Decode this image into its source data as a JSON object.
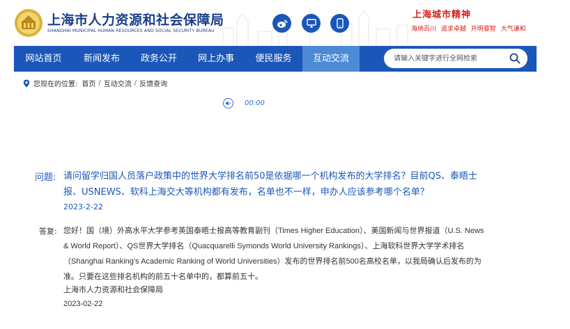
{
  "header": {
    "title": "上海市人力资源和社会保障局",
    "subtitle": "SHANGHAI MUNICIPAL HUMAN RESOURCES AND SOCIAL SECURITY BUREAU",
    "icons": [
      "weibo-icon",
      "desktop-icon",
      "mobile-icon"
    ],
    "city_spirit": {
      "title": "上海城市精神",
      "phrases": [
        "海纳百川",
        "追求卓越",
        "开明睿智",
        "大气谦和"
      ]
    }
  },
  "nav": {
    "items": [
      {
        "label": "网站首页",
        "active": false
      },
      {
        "label": "新闻发布",
        "active": false
      },
      {
        "label": "政务公开",
        "active": false
      },
      {
        "label": "网上办事",
        "active": false
      },
      {
        "label": "便民服务",
        "active": false
      },
      {
        "label": "互动交流",
        "active": true
      }
    ],
    "search_placeholder": "请输入关键字进行全网检索"
  },
  "breadcrumb": {
    "prefix": "您现在的位置:",
    "items": [
      "首页",
      "互动交流",
      "反馈查询"
    ],
    "separator": "/"
  },
  "audio": {
    "time": "00:00"
  },
  "qa": {
    "question_label": "问题:",
    "question": "请问留学归国人员落户政策中的世界大学排名前50是依据哪一个机构发布的大学排名？目前QS、泰晤士报、USNEWS、软科上海交大等机构都有发布，名单也不一样，申办人应该参考哪个名单？",
    "question_date": "2023-2-22",
    "answer_label": "答复:",
    "answer": "您好！国（境）外高水平大学参考英国泰晤士报高等教育副刊（Times Higher Education）、美国新闻与世界报道（U.S. News & World Report）、QS世界大学排名（Quacquarelli Symonds World University Rankings）、上海软科世界大学学术排名（Shanghai Ranking’s Academic Ranking of World Universities）发布的世界排名前500名高校名单，以我局确认后发布的为准。只要在这些排名机构的前五十名单中的，都算前五十。",
    "answer_org": "上海市人力资源和社会保障局",
    "answer_date": "2023-02-22"
  },
  "colors": {
    "brand_blue": "#1a57b8",
    "nav_active": "#4d8ad6",
    "spirit_red": "#d9201b"
  }
}
